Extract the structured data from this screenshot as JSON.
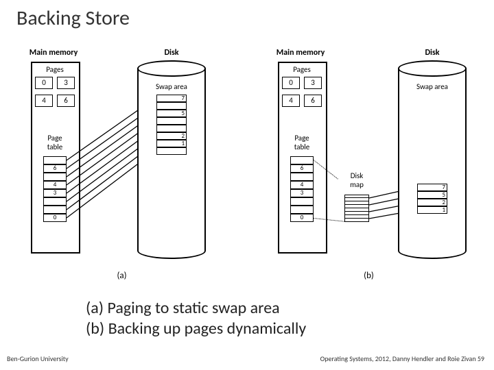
{
  "title": "Backing Store",
  "caption_a": "(a) Paging to static swap area",
  "caption_b": "(b) Backing up pages dynamically",
  "footer_left": "Ben-Gurion University",
  "footer_right": "Operating Systems, 2012, Danny Hendler and Roie Zivan",
  "page_number": "59",
  "labels": {
    "main_memory": "Main memory",
    "disk": "Disk",
    "pages": "Pages",
    "swap_area": "Swap area",
    "page_table": "Page",
    "page_table2": "table",
    "disk_map": "Disk",
    "disk_map2": "map"
  },
  "page_cells": [
    "0",
    "3",
    "4",
    "6"
  ],
  "swap_rows_a": [
    "7",
    "",
    "5",
    "",
    "",
    "2",
    "1",
    ""
  ],
  "swap_rows_b": [
    "7",
    "5",
    "2",
    "1"
  ],
  "page_table_rows": [
    "",
    "6",
    "",
    "4",
    "3",
    "",
    "",
    "0"
  ],
  "figure_labels": {
    "a": "(a)",
    "b": "(b)"
  }
}
